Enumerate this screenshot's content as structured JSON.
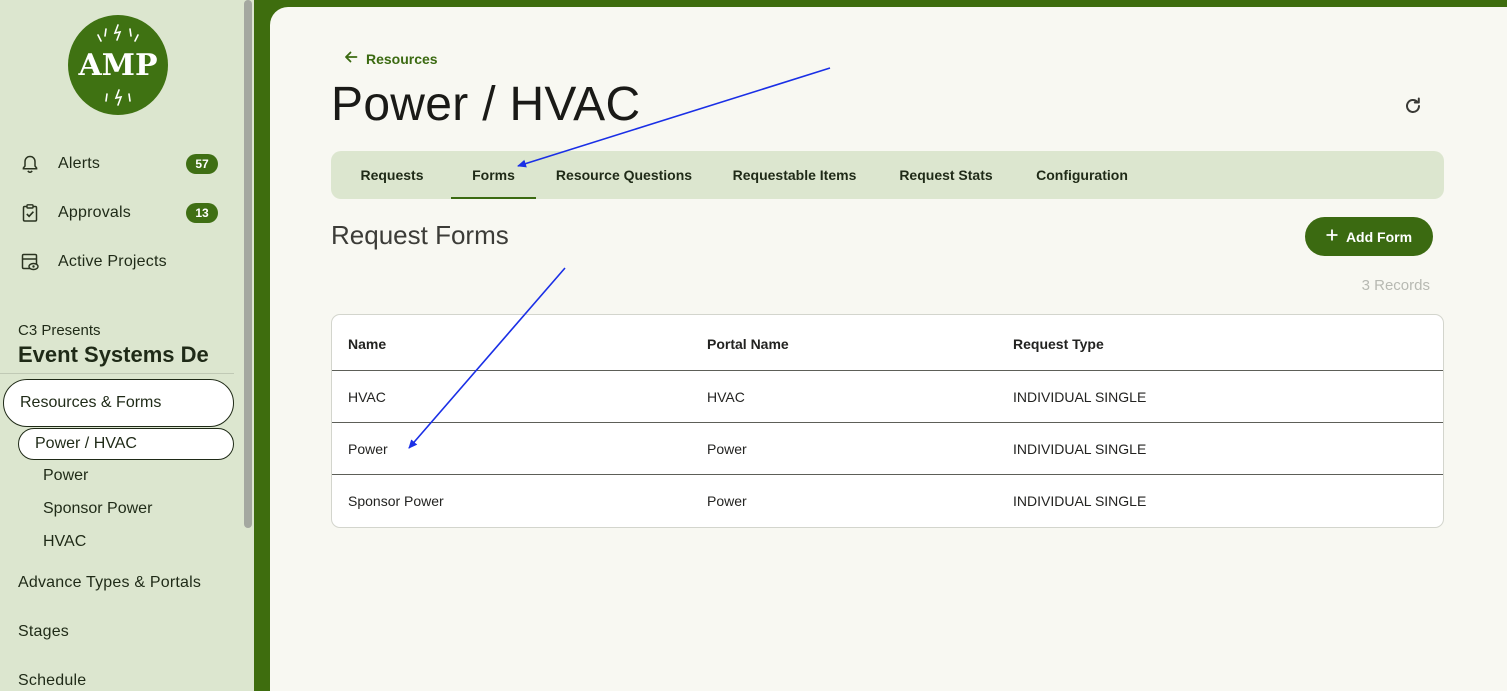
{
  "sidebar": {
    "logo_text": "AMP",
    "nav": [
      {
        "label": "Alerts",
        "badge": "57",
        "icon": "bell-icon"
      },
      {
        "label": "Approvals",
        "badge": "13",
        "icon": "clipboard-check-icon"
      },
      {
        "label": "Active Projects",
        "icon": "project-eye-icon"
      }
    ],
    "org_subtitle": "C3 Presents",
    "org_title": "Event Systems De",
    "resources_forms": "Resources & Forms",
    "current_resource": "Power / HVAC",
    "sub_items": [
      "Power",
      "Sponsor Power",
      "HVAC"
    ],
    "sections": [
      "Advance Types & Portals",
      "Stages",
      "Schedule"
    ]
  },
  "main": {
    "back_label": "Resources",
    "title": "Power / HVAC",
    "tabs": [
      {
        "label": "Requests",
        "active": false
      },
      {
        "label": "Forms",
        "active": true
      },
      {
        "label": "Resource Questions",
        "active": false
      },
      {
        "label": "Requestable Items",
        "active": false
      },
      {
        "label": "Request Stats",
        "active": false
      },
      {
        "label": "Configuration",
        "active": false
      }
    ],
    "section_title": "Request Forms",
    "add_button": "Add Form",
    "records_count": "3 Records",
    "table": {
      "columns": [
        "Name",
        "Portal Name",
        "Request Type"
      ],
      "rows": [
        [
          "HVAC",
          "HVAC",
          "INDIVIDUAL SINGLE"
        ],
        [
          "Power",
          "Power",
          "INDIVIDUAL SINGLE"
        ],
        [
          "Sponsor Power",
          "Power",
          "INDIVIDUAL SINGLE"
        ]
      ]
    }
  },
  "colors": {
    "brand_green": "#3b6a11",
    "sidebar_bg": "#dce6cf",
    "annotation_blue": "#1a2fe6"
  }
}
